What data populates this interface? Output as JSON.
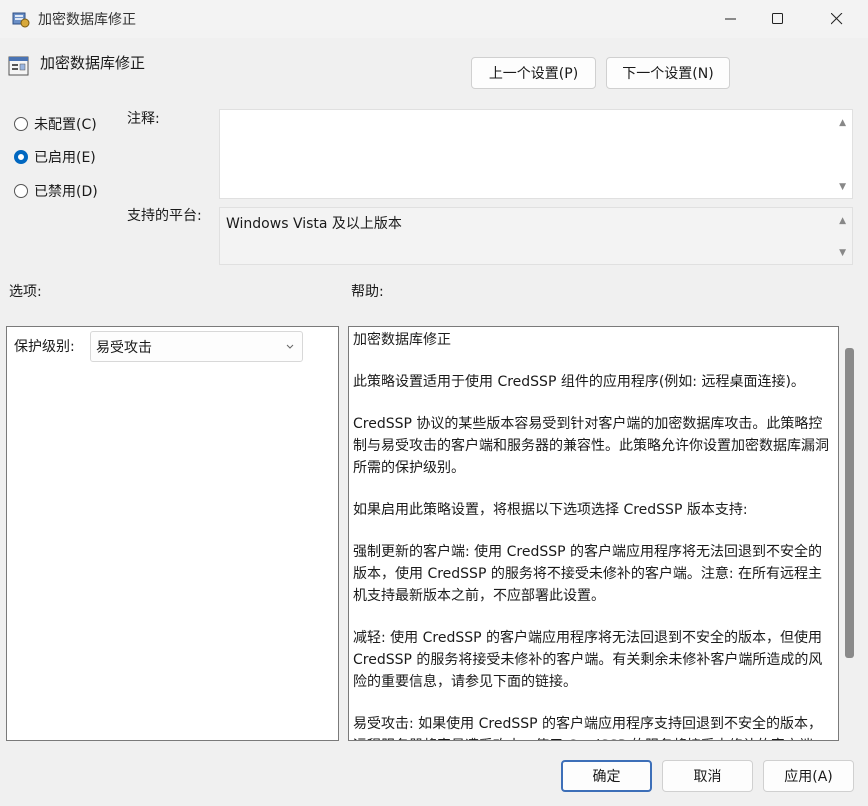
{
  "window": {
    "title": "加密数据库修正",
    "minimize_icon": "minimize-icon",
    "maximize_icon": "maximize-icon",
    "close_icon": "close-icon"
  },
  "header": {
    "policy_title": "加密数据库修正",
    "prev_button": "上一个设置(P)",
    "next_button": "下一个设置(N)"
  },
  "state": {
    "options": [
      {
        "label": "未配置(C)",
        "checked": false
      },
      {
        "label": "已启用(E)",
        "checked": true
      },
      {
        "label": "已禁用(D)",
        "checked": false
      }
    ]
  },
  "comment": {
    "label": "注释:",
    "value": ""
  },
  "platform": {
    "label": "支持的平台:",
    "value": "Windows Vista 及以上版本"
  },
  "options_section": {
    "label": "选项:",
    "protection_label": "保护级别:",
    "protection_value": "易受攻击"
  },
  "help_section": {
    "label": "帮助:",
    "paragraphs": [
      "加密数据库修正",
      "此策略设置适用于使用 CredSSP 组件的应用程序(例如: 远程桌面连接)。",
      "CredSSP 协议的某些版本容易受到针对客户端的加密数据库攻击。此策略控制与易受攻击的客户端和服务器的兼容性。此策略允许你设置加密数据库漏洞所需的保护级别。",
      "如果启用此策略设置，将根据以下选项选择 CredSSP 版本支持:",
      "强制更新的客户端: 使用 CredSSP 的客户端应用程序将无法回退到不安全的版本，使用 CredSSP 的服务将不接受未修补的客户端。注意: 在所有远程主机支持最新版本之前，不应部署此设置。",
      "减轻: 使用 CredSSP 的客户端应用程序将无法回退到不安全的版本，但使用 CredSSP 的服务将接受未修补的客户端。有关剩余未修补客户端所造成的风险的重要信息，请参见下面的链接。",
      "易受攻击: 如果使用 CredSSP 的客户端应用程序支持回退到不安全的版本，远程服务器将容易遭受攻击，使用 CredSSP 的服务将接受未修补的客户端。"
    ]
  },
  "footer": {
    "ok": "确定",
    "cancel": "取消",
    "apply": "应用(A)"
  },
  "colors": {
    "accent": "#0067c0",
    "primary_button_border": "#3d6fb8"
  }
}
